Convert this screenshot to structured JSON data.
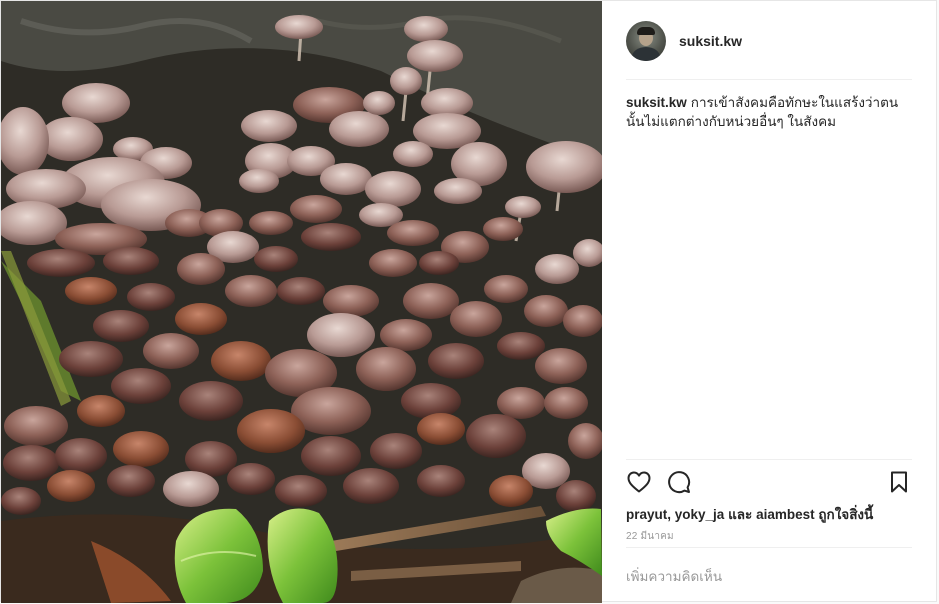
{
  "post": {
    "username": "suksit.kw",
    "caption": {
      "username": "suksit.kw",
      "text": "การเข้าสังคมคือทักษะในแสร้งว่าตนนั้นไม่แตกต่างกับหน่วยอื่นๆ ในสังคม"
    },
    "likes": {
      "user1": "prayut",
      "sep": ", ",
      "user2": "yoky_ja",
      "and": " และ ",
      "user3": "aiambest",
      "suffix": " ถูกใจสิ่งนี้"
    },
    "date": "22 มีนาคม",
    "comment_placeholder": "เพิ่มความคิดเห็น"
  },
  "icons": {
    "like": "heart-icon",
    "comment": "speech-bubble-icon",
    "save": "bookmark-icon"
  },
  "colors": {
    "text": "#262626",
    "secondary": "#999999",
    "divider": "#efefef"
  }
}
